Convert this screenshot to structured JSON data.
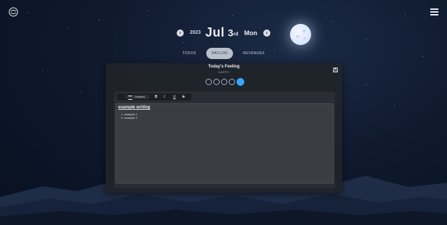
{
  "header": {
    "year": "2023",
    "month": "Jul",
    "day": "3",
    "day_suffix": "rd",
    "weekday": "Mon"
  },
  "tabs": [
    {
      "label": "TODOS",
      "active": false
    },
    {
      "label": "DAYLOG",
      "active": true
    },
    {
      "label": "REVENUES",
      "active": false
    }
  ],
  "panel": {
    "title": "Today's Feeling",
    "subtitle": "HAPPY",
    "mood_options": [
      "very-sad",
      "sad",
      "neutral",
      "content",
      "happy"
    ],
    "selected_mood": "happy"
  },
  "toolbar": {
    "list_type": "Ordered",
    "bold": "B",
    "italic": "I",
    "underline": "U",
    "strikethrough": "S"
  },
  "editor": {
    "heading": "example writing",
    "items": [
      "1. example 1",
      "2. example 2"
    ]
  },
  "colors": {
    "accent": "#3aa5ff",
    "panel_bg": "#212429",
    "editor_bg": "#3a3d42"
  }
}
